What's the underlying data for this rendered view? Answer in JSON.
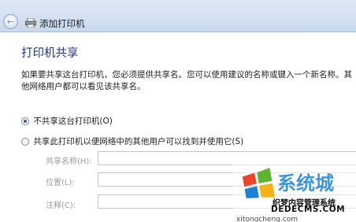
{
  "window": {
    "title": "添加打印机"
  },
  "page": {
    "title": "打印机共享",
    "description": "如果要共享这台打印机，您必须提供共享名。您可以使用建议的名称或键入一个新名称。其他网络用户都可以看见该共享名。"
  },
  "options": {
    "no_share": {
      "label": "不共享这台打印机(O)",
      "selected": true
    },
    "share": {
      "label": "共享此打印机以便网络中的其他用户可以找到并使用它(S)",
      "selected": false
    }
  },
  "fields": {
    "share_name": {
      "label": "共享名称(H):",
      "value": ""
    },
    "location": {
      "label": "位置(L):",
      "value": ""
    },
    "comment": {
      "label": "注释(C):",
      "value": ""
    }
  },
  "watermark": {
    "brand": "系统城",
    "line1": "织梦内容管理系统",
    "line2": "DEDECMS.COM",
    "domain": "xitongcheng.com"
  }
}
